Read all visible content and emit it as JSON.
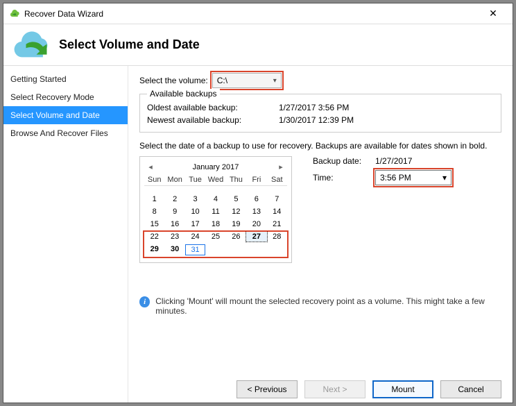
{
  "window": {
    "title": "Recover Data Wizard"
  },
  "header": {
    "title": "Select Volume and Date"
  },
  "sidebar": {
    "steps": [
      {
        "label": "Getting Started"
      },
      {
        "label": "Select Recovery Mode"
      },
      {
        "label": "Select Volume and Date"
      },
      {
        "label": "Browse And Recover Files"
      }
    ],
    "activeIndex": 2
  },
  "volume": {
    "label": "Select the volume:",
    "selected": "C:\\"
  },
  "available": {
    "groupTitle": "Available backups",
    "oldestLabel": "Oldest available backup:",
    "oldestValue": "1/27/2017 3:56 PM",
    "newestLabel": "Newest available backup:",
    "newestValue": "1/30/2017 12:39 PM"
  },
  "instructions": "Select the date of a backup to use for recovery. Backups are available for dates shown in bold.",
  "calendar": {
    "month": "January 2017",
    "dow": [
      "Sun",
      "Mon",
      "Tue",
      "Wed",
      "Thu",
      "Fri",
      "Sat"
    ],
    "weeks": [
      [
        null,
        null,
        null,
        null,
        null,
        null,
        null
      ],
      [
        1,
        2,
        3,
        4,
        5,
        6,
        7
      ],
      [
        8,
        9,
        10,
        11,
        12,
        13,
        14
      ],
      [
        15,
        16,
        17,
        18,
        19,
        20,
        21
      ],
      [
        22,
        23,
        24,
        25,
        26,
        27,
        28
      ],
      [
        29,
        30,
        31,
        null,
        null,
        null,
        null
      ]
    ],
    "boldDays": [
      27,
      29,
      30
    ],
    "selectedDay": 27,
    "todayDay": 31
  },
  "backupParams": {
    "dateLabel": "Backup date:",
    "dateValue": "1/27/2017",
    "timeLabel": "Time:",
    "timeValue": "3:56 PM"
  },
  "info": "Clicking 'Mount' will mount the selected recovery point as a volume. This might take a few minutes.",
  "buttons": {
    "previous": "<  Previous",
    "next": "Next  >",
    "mount": "Mount",
    "cancel": "Cancel"
  }
}
